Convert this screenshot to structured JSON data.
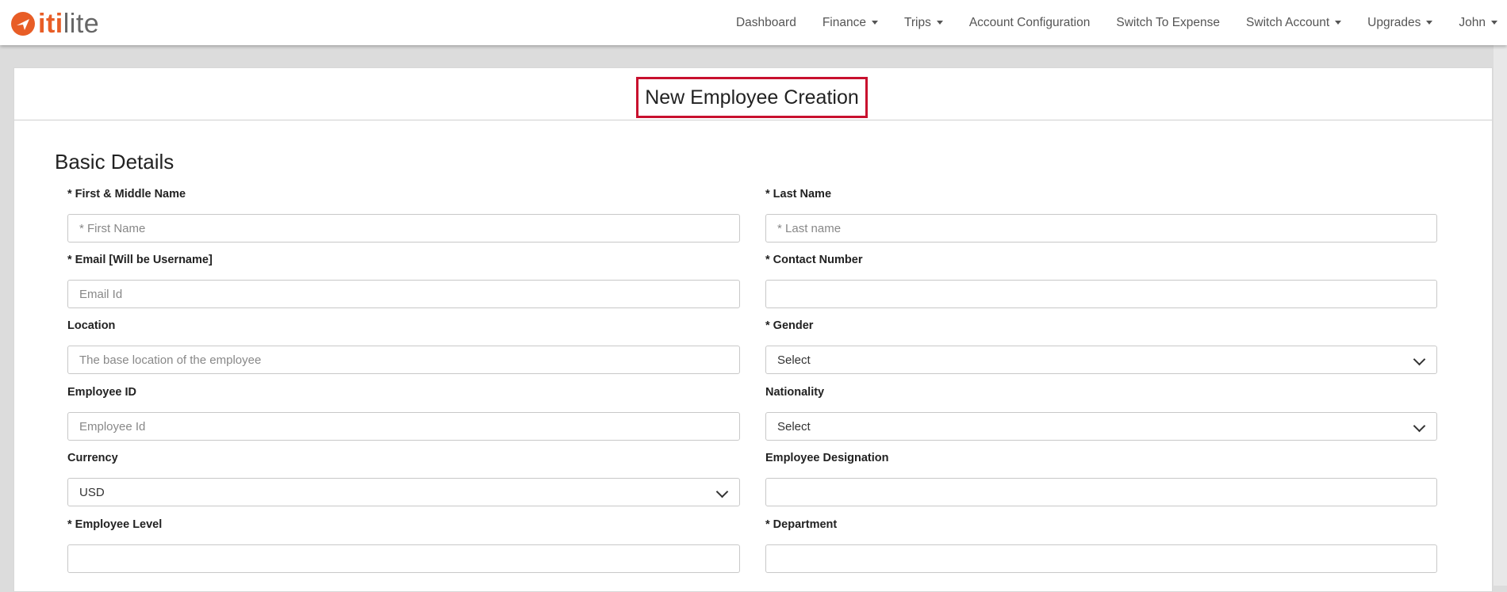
{
  "brand": {
    "logo_text_accent": "iti",
    "logo_text_rest": "lite",
    "accent_color": "#e85d26"
  },
  "nav": {
    "items": [
      {
        "label": "Dashboard",
        "dropdown": false
      },
      {
        "label": "Finance",
        "dropdown": true
      },
      {
        "label": "Trips",
        "dropdown": true
      },
      {
        "label": "Account Configuration",
        "dropdown": false
      },
      {
        "label": "Switch To Expense",
        "dropdown": false
      },
      {
        "label": "Switch Account",
        "dropdown": true
      },
      {
        "label": "Upgrades",
        "dropdown": true
      },
      {
        "label": "John",
        "dropdown": true
      }
    ]
  },
  "page": {
    "title": "New Employee Creation",
    "highlight_color": "#c8102e"
  },
  "form": {
    "section_title": "Basic Details",
    "fields": {
      "first_name": {
        "label": "* First & Middle Name",
        "placeholder": "* First Name",
        "value": ""
      },
      "last_name": {
        "label": "* Last Name",
        "placeholder": "* Last name",
        "value": ""
      },
      "email": {
        "label": "* Email [Will be Username]",
        "placeholder": "Email Id",
        "value": ""
      },
      "contact": {
        "label": "* Contact Number",
        "placeholder": "",
        "value": ""
      },
      "location": {
        "label": "Location",
        "placeholder": "The base location of the employee",
        "value": ""
      },
      "gender": {
        "label": "* Gender",
        "selected": "Select"
      },
      "employee_id": {
        "label": "Employee ID",
        "placeholder": "Employee Id",
        "value": ""
      },
      "nationality": {
        "label": "Nationality",
        "selected": "Select"
      },
      "currency": {
        "label": "Currency",
        "selected": "USD"
      },
      "designation": {
        "label": "Employee Designation",
        "placeholder": "",
        "value": ""
      },
      "level": {
        "label": "* Employee Level",
        "placeholder": "",
        "value": ""
      },
      "department": {
        "label": "* Department",
        "placeholder": "",
        "value": ""
      }
    }
  }
}
